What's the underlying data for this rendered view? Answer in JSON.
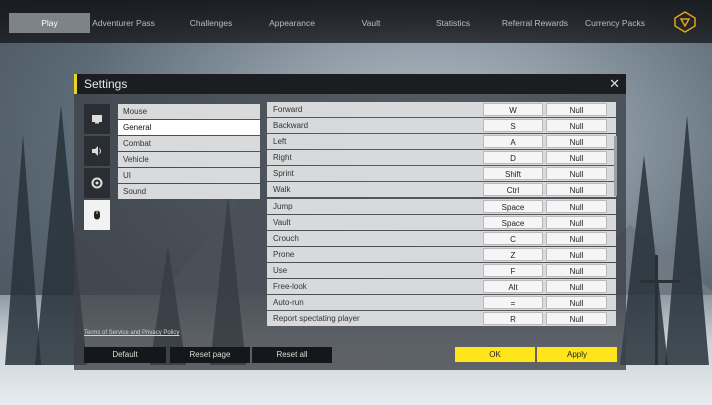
{
  "nav": {
    "tabs": [
      {
        "label": "Play",
        "active": true
      },
      {
        "label": "Adventurer Pass"
      },
      {
        "label": "Challenges"
      },
      {
        "label": "Appearance"
      },
      {
        "label": "Vault"
      },
      {
        "label": "Statistics"
      },
      {
        "label": "Referral Rewards"
      },
      {
        "label": "Currency Packs"
      }
    ],
    "logo_icon": "triangle-logo-icon"
  },
  "settings": {
    "title": "Settings",
    "close_icon": "close-icon",
    "side_icons": [
      "display-icon",
      "speaker-icon",
      "gear-icon",
      "mouse-icon"
    ],
    "categories": [
      {
        "label": "Mouse"
      },
      {
        "label": "General",
        "active": true
      },
      {
        "label": "Combat"
      },
      {
        "label": "Vehicle"
      },
      {
        "label": "UI"
      },
      {
        "label": "Sound"
      }
    ],
    "bindings": [
      {
        "action": "Forward",
        "primary": "W",
        "secondary": "Null"
      },
      {
        "action": "Backward",
        "primary": "S",
        "secondary": "Null"
      },
      {
        "action": "Left",
        "primary": "A",
        "secondary": "Null"
      },
      {
        "action": "Right",
        "primary": "D",
        "secondary": "Null"
      },
      {
        "action": "Sprint",
        "primary": "Shift",
        "secondary": "Null"
      },
      {
        "action": "Walk",
        "primary": "Ctrl",
        "secondary": "Null"
      },
      {
        "action": "Jump",
        "primary": "Space",
        "secondary": "Null"
      },
      {
        "action": "Vault",
        "primary": "Space",
        "secondary": "Null"
      },
      {
        "action": "Crouch",
        "primary": "C",
        "secondary": "Null"
      },
      {
        "action": "Prone",
        "primary": "Z",
        "secondary": "Null"
      },
      {
        "action": "Use",
        "primary": "F",
        "secondary": "Null"
      },
      {
        "action": "Free-look",
        "primary": "Alt",
        "secondary": "Null"
      },
      {
        "action": "Auto-run",
        "primary": "=",
        "secondary": "Null"
      },
      {
        "action": "Report spectating player",
        "primary": "R",
        "secondary": "Null"
      }
    ],
    "legal": "Terms of Service and Privacy Policy",
    "buttons": {
      "default": "Default",
      "reset_page": "Reset page",
      "reset_all": "Reset all",
      "ok": "OK",
      "apply": "Apply"
    }
  },
  "colors": {
    "accent": "#ffe51a",
    "panel_title": "#1b1d20"
  }
}
